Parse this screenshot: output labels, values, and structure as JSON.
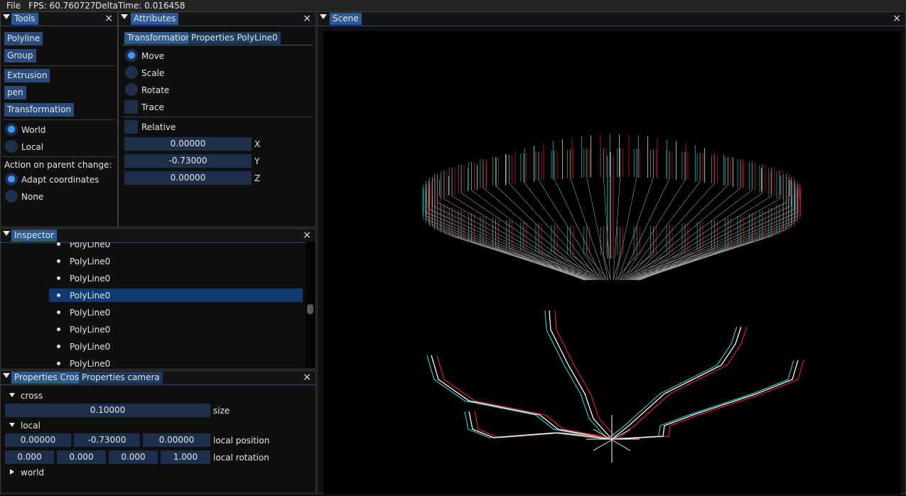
{
  "menubar": {
    "file": "File",
    "fps": "FPS: 60.760727",
    "delta": "DeltaTime: 0.016458"
  },
  "tools": {
    "title": "Tools",
    "buttons": [
      "Polyline",
      "Group",
      "Extrusion",
      "pen",
      "Transformation"
    ],
    "space_options": [
      "World",
      "Local"
    ],
    "space_selected": "World",
    "parent_change_label": "Action on parent change:",
    "parent_options": [
      "Adapt coordinates",
      "None"
    ],
    "parent_selected": "Adapt coordinates"
  },
  "attributes": {
    "title": "Attributes",
    "tabs": [
      "Transformation",
      "Properties PolyLine0"
    ],
    "mode_options": [
      "Move",
      "Scale",
      "Rotate"
    ],
    "mode_selected": "Move",
    "trace_label": "Trace",
    "relative_label": "Relative",
    "x": {
      "value": "0.00000",
      "label": "X"
    },
    "y": {
      "value": "-0.73000",
      "label": "Y"
    },
    "z": {
      "value": "0.00000",
      "label": "Z"
    }
  },
  "inspector": {
    "title": "Inspector",
    "items": [
      "PolyLine0",
      "PolyLine0",
      "PolyLine0",
      "PolyLine0",
      "PolyLine0",
      "PolyLine0",
      "PolyLine0",
      "PolyLine0"
    ],
    "selected_index": 3,
    "scroll_position": 0.5
  },
  "properties": {
    "tabs": [
      "Properties Cross",
      "Properties camera"
    ],
    "cross_label": "cross",
    "size_value": "0.10000",
    "size_label": "size",
    "local_label": "local",
    "local_position": [
      "0.00000",
      "-0.73000",
      "0.00000"
    ],
    "local_position_label": "local position",
    "local_rotation": [
      "0.000",
      "0.000",
      "0.000",
      "1.000"
    ],
    "local_rotation_label": "local rotation",
    "world_label": "world"
  },
  "scene": {
    "title": "Scene"
  },
  "colors": {
    "accent": "#4296fa",
    "tab_active": "#2d5a91",
    "button": "#294a7a",
    "frame": "#1d2f4a",
    "selection": "#0d3a70"
  }
}
